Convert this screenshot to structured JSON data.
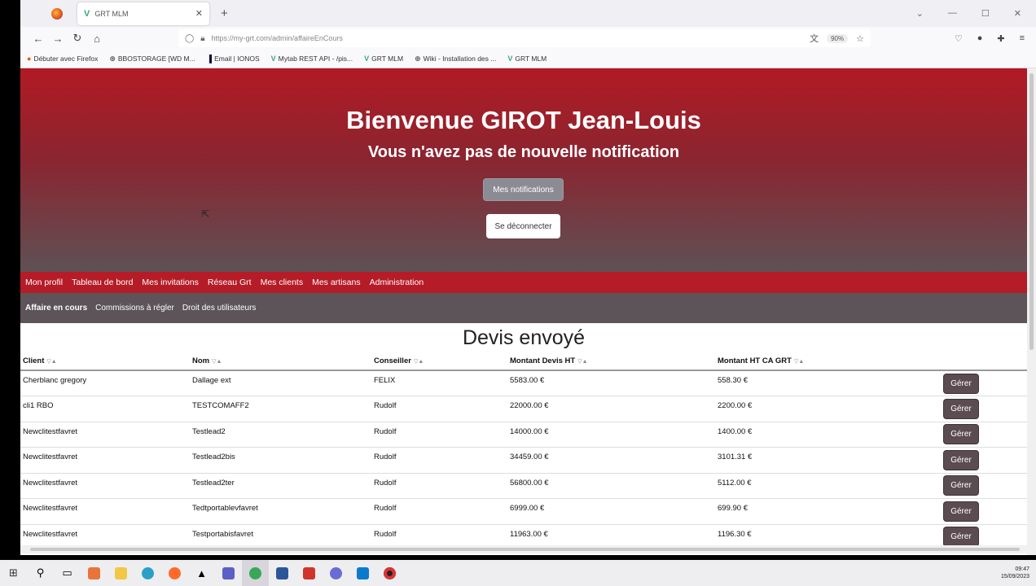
{
  "browser": {
    "tab_title": "GRT MLM",
    "url": "https://my-grt.com/admin/affaireEnCours",
    "zoom": "90%",
    "bookmarks": [
      {
        "label": "Débuter avec Firefox",
        "icon": "firefox-icon"
      },
      {
        "label": "BBOSTORAGE [WD M...",
        "icon": "globe-icon"
      },
      {
        "label": "Email | IONOS",
        "icon": "ionos-icon"
      },
      {
        "label": "Mytab REST API - /pis...",
        "icon": "vue-icon"
      },
      {
        "label": "GRT MLM",
        "icon": "vue-icon"
      },
      {
        "label": "Wiki - Installation des ...",
        "icon": "globe-icon"
      },
      {
        "label": "GRT MLM",
        "icon": "vue-icon"
      }
    ]
  },
  "hero": {
    "welcome": "Bienvenue GIROT Jean-Louis",
    "notification_text": "Vous n'avez pas de nouvelle notification",
    "notifications_button": "Mes notifications",
    "logout_button": "Se déconnecter"
  },
  "main_nav": [
    "Mon profil",
    "Tableau de bord",
    "Mes invitations",
    "Réseau Grt",
    "Mes clients",
    "Mes artisans",
    "Administration"
  ],
  "sub_nav": {
    "active": "Affaire en cours",
    "items": [
      "Commissions à régler",
      "Droit des utilisateurs"
    ]
  },
  "section_title": "Devis envoyé",
  "table": {
    "headers": [
      "Client",
      "Nom",
      "Conseiller",
      "Montant Devis HT",
      "Montant HT CA GRT"
    ],
    "sort_icon": "▽▲",
    "action_label": "Gérer",
    "rows": [
      [
        "Cherblanc gregory",
        "Dallage ext",
        "FELIX",
        "5583.00 €",
        "558.30 €"
      ],
      [
        "cli1 RBO",
        "TESTCOMAFF2",
        "Rudolf",
        "22000.00 €",
        "2200.00 €"
      ],
      [
        "Newclitestfavret",
        "Testlead2",
        "Rudolf",
        "14000.00 €",
        "1400.00 €"
      ],
      [
        "Newclitestfavret",
        "Testlead2bis",
        "Rudolf",
        "34459.00 €",
        "3101.31 €"
      ],
      [
        "Newclitestfavret",
        "Testlead2ter",
        "Rudolf",
        "56800.00 €",
        "5112.00 €"
      ],
      [
        "Newclitestfavret",
        "Tedtportablevfavret",
        "Rudolf",
        "6999.00 €",
        "699.90 €"
      ],
      [
        "Newclitestfavret",
        "Testportabisfavret",
        "Rudolf",
        "11963.00 €",
        "1196.30 €"
      ]
    ]
  },
  "taskbar": {
    "time": "09:47",
    "date": "15/09/2023"
  }
}
